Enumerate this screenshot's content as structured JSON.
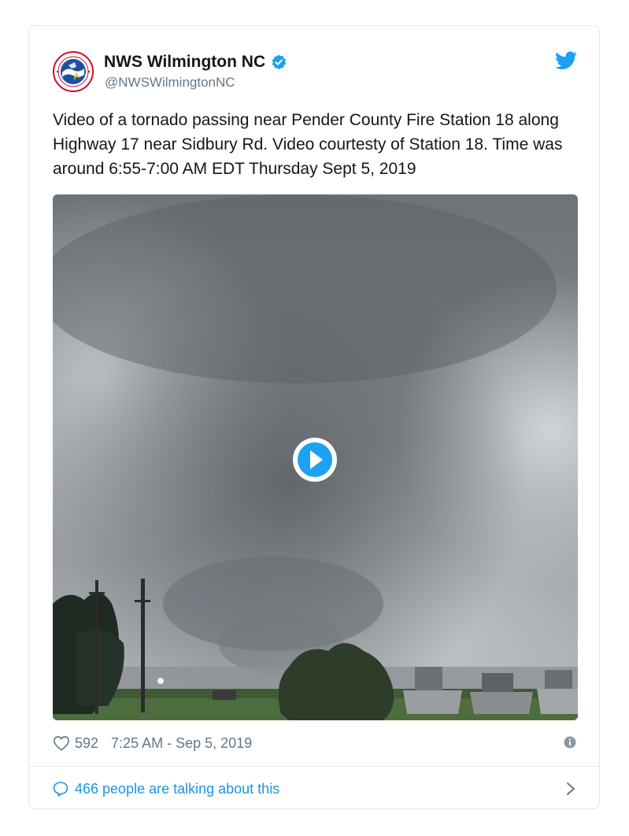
{
  "author": {
    "name": "NWS Wilmington NC",
    "handle": "@NWSWilmingtonNC",
    "avatar_icon": "nws-logo-icon",
    "verified_icon": "verified-badge-icon"
  },
  "tweet": {
    "text": "Video of a tornado passing near Pender County Fire Station 18 along Highway 17 near Sidbury Rd. Video courtesty of Station 18. Time was around 6:55-7:00 AM EDT Thursday Sept 5, 2019"
  },
  "media": {
    "type": "video",
    "play_icon": "play-icon"
  },
  "meta": {
    "likes": "592",
    "timestamp": "7:25 AM - Sep 5, 2019",
    "heart_icon": "heart-icon",
    "info_icon": "info-icon"
  },
  "footer": {
    "talking_label": "466 people are talking about this",
    "bubble_icon": "speech-bubble-icon",
    "chevron_icon": "chevron-right-icon"
  },
  "colors": {
    "twitter_blue": "#1da1f2",
    "link_blue": "#1b95e0",
    "text": "#14171a",
    "muted": "#657786",
    "border": "#e1e8ed"
  }
}
